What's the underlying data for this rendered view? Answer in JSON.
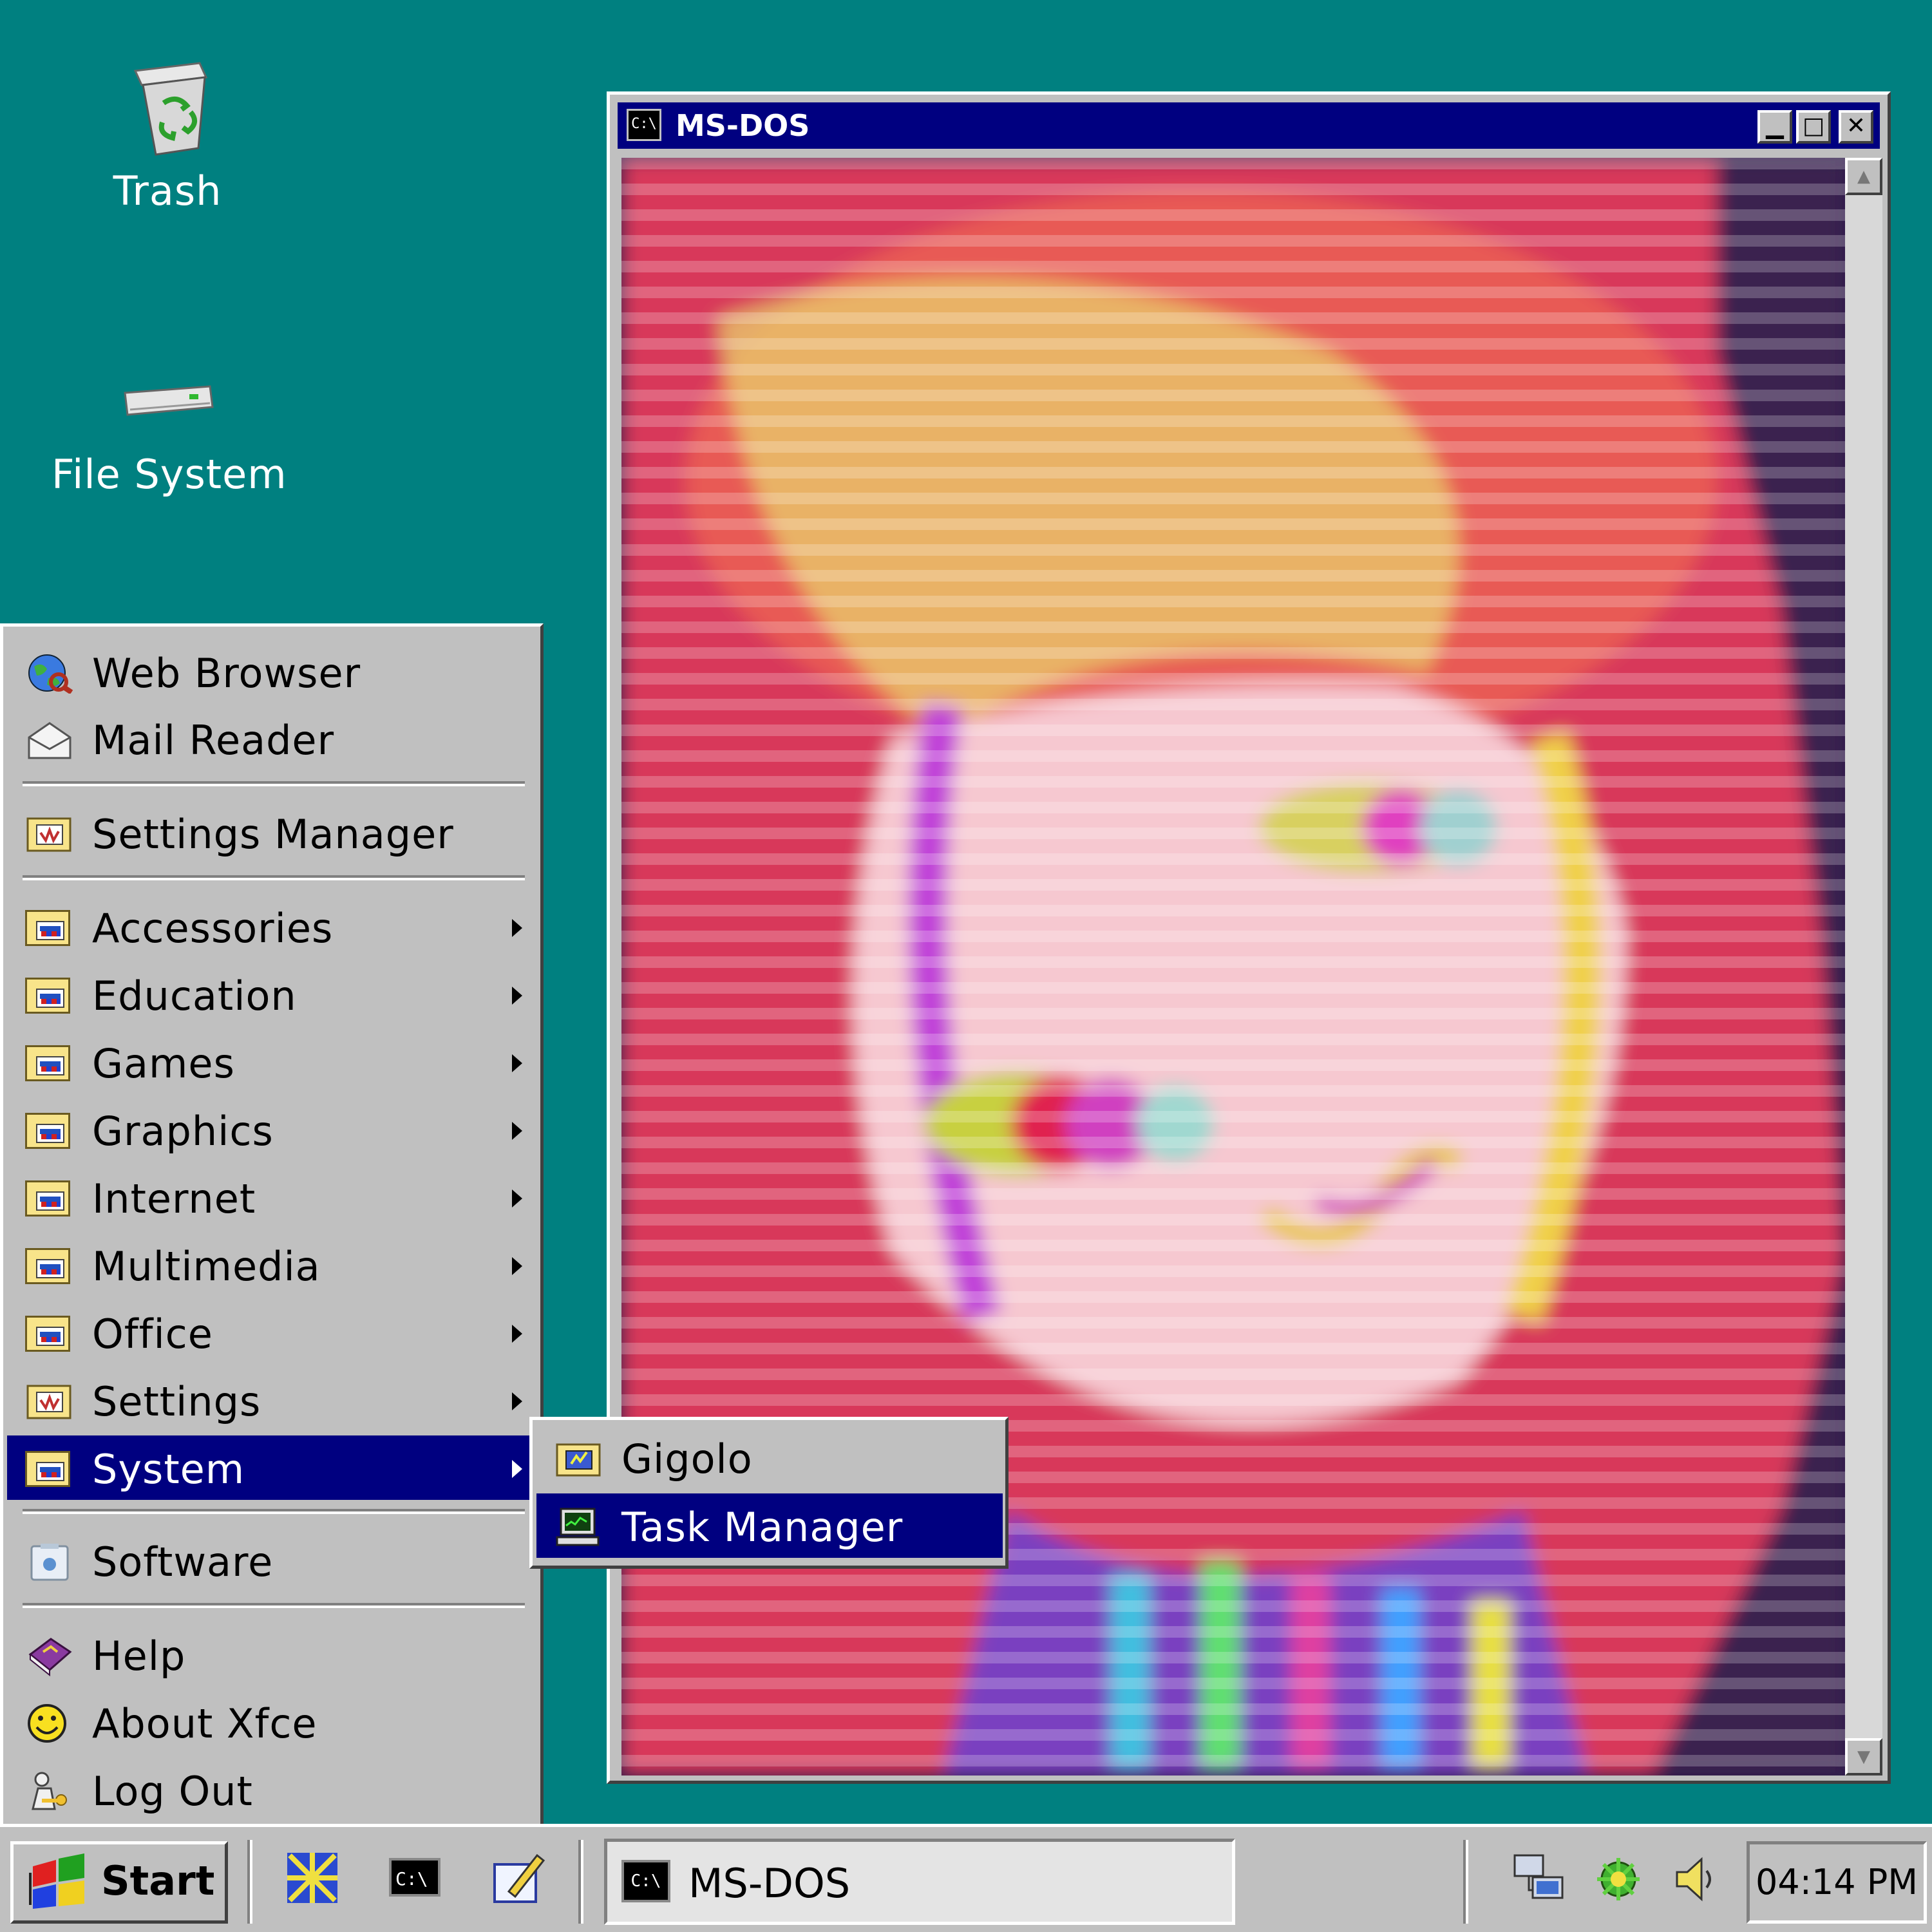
{
  "desktop": {
    "icons": [
      {
        "name": "trash-icon",
        "label": "Trash"
      },
      {
        "name": "file-system-icon",
        "label": "File System"
      }
    ]
  },
  "window": {
    "title": "MS-DOS",
    "title_icon_text": "C:\\",
    "controls": {
      "minimize": "▁",
      "maximize": "□",
      "close": "✕"
    }
  },
  "start_menu": {
    "items": [
      {
        "label": "Web Browser",
        "icon": "web-browser-icon"
      },
      {
        "label": "Mail Reader",
        "icon": "mail-icon"
      },
      {
        "label": "Settings Manager",
        "icon": "settings-manager-icon"
      },
      {
        "label": "Accessories",
        "icon": "folder-icon",
        "submenu": true
      },
      {
        "label": "Education",
        "icon": "folder-icon",
        "submenu": true
      },
      {
        "label": "Games",
        "icon": "folder-icon",
        "submenu": true
      },
      {
        "label": "Graphics",
        "icon": "folder-icon",
        "submenu": true
      },
      {
        "label": "Internet",
        "icon": "folder-icon",
        "submenu": true
      },
      {
        "label": "Multimedia",
        "icon": "folder-icon",
        "submenu": true
      },
      {
        "label": "Office",
        "icon": "folder-icon",
        "submenu": true
      },
      {
        "label": "Settings",
        "icon": "settings-folder-icon",
        "submenu": true
      },
      {
        "label": "System",
        "icon": "folder-icon",
        "submenu": true,
        "selected": true
      },
      {
        "label": "Software",
        "icon": "software-icon"
      },
      {
        "label": "Help",
        "icon": "help-book-icon"
      },
      {
        "label": "About Xfce",
        "icon": "smiley-icon"
      },
      {
        "label": "Log Out",
        "icon": "log-out-icon"
      }
    ]
  },
  "system_submenu": {
    "items": [
      {
        "label": "Gigolo",
        "icon": "gigolo-icon"
      },
      {
        "label": "Task Manager",
        "icon": "task-manager-icon",
        "selected": true
      }
    ]
  },
  "taskbar": {
    "start_label": "Start",
    "quick_launch": [
      "system-tool-icon",
      "terminal-icon",
      "text-editor-icon"
    ],
    "tasks": [
      {
        "label": "MS-DOS",
        "icon_text": "C:\\"
      }
    ],
    "tray": [
      "network-icon",
      "update-notifier-icon",
      "volume-icon"
    ],
    "clock": "04:14 PM"
  },
  "colors": {
    "desktop": "#008080",
    "title_bar": "#000080",
    "selection": "#000080",
    "menu_bg": "#c0c0c0"
  }
}
